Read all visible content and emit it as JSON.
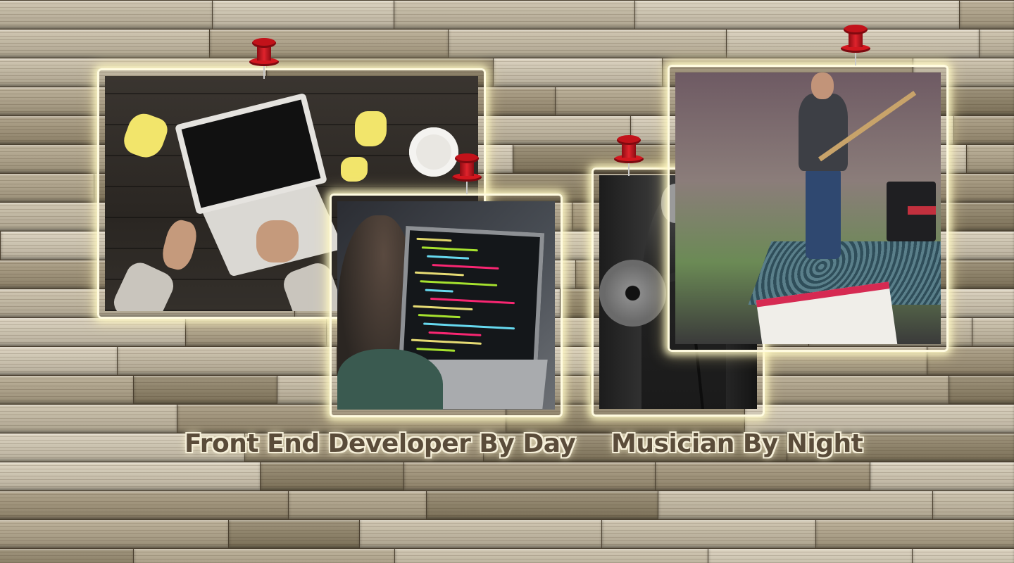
{
  "captions": {
    "day": "Front End Developer By Day",
    "night": "Musician By Night"
  },
  "photos": [
    {
      "id": "laptop-desk"
    },
    {
      "id": "coding-macbook"
    },
    {
      "id": "acoustic-guitar"
    },
    {
      "id": "bass-on-stage"
    }
  ],
  "code_lines": [
    {
      "color": "#e2d96b",
      "w": 50
    },
    {
      "color": "#a6e22e",
      "w": 80
    },
    {
      "color": "#66d9ef",
      "w": 60
    },
    {
      "color": "#f92672",
      "w": 95
    },
    {
      "color": "#e6db74",
      "w": 70
    },
    {
      "color": "#a6e22e",
      "w": 110
    },
    {
      "color": "#66d9ef",
      "w": 40
    },
    {
      "color": "#f92672",
      "w": 120
    },
    {
      "color": "#e6db74",
      "w": 85
    },
    {
      "color": "#a6e22e",
      "w": 60
    },
    {
      "color": "#66d9ef",
      "w": 130
    },
    {
      "color": "#f92672",
      "w": 75
    },
    {
      "color": "#e6db74",
      "w": 100
    },
    {
      "color": "#a6e22e",
      "w": 55
    }
  ],
  "colors": {
    "caption_text": "#5a4c3a",
    "caption_glow": "#f6f0da",
    "pin_red": "#c2121a",
    "frame_glow": "#fffbe0"
  }
}
